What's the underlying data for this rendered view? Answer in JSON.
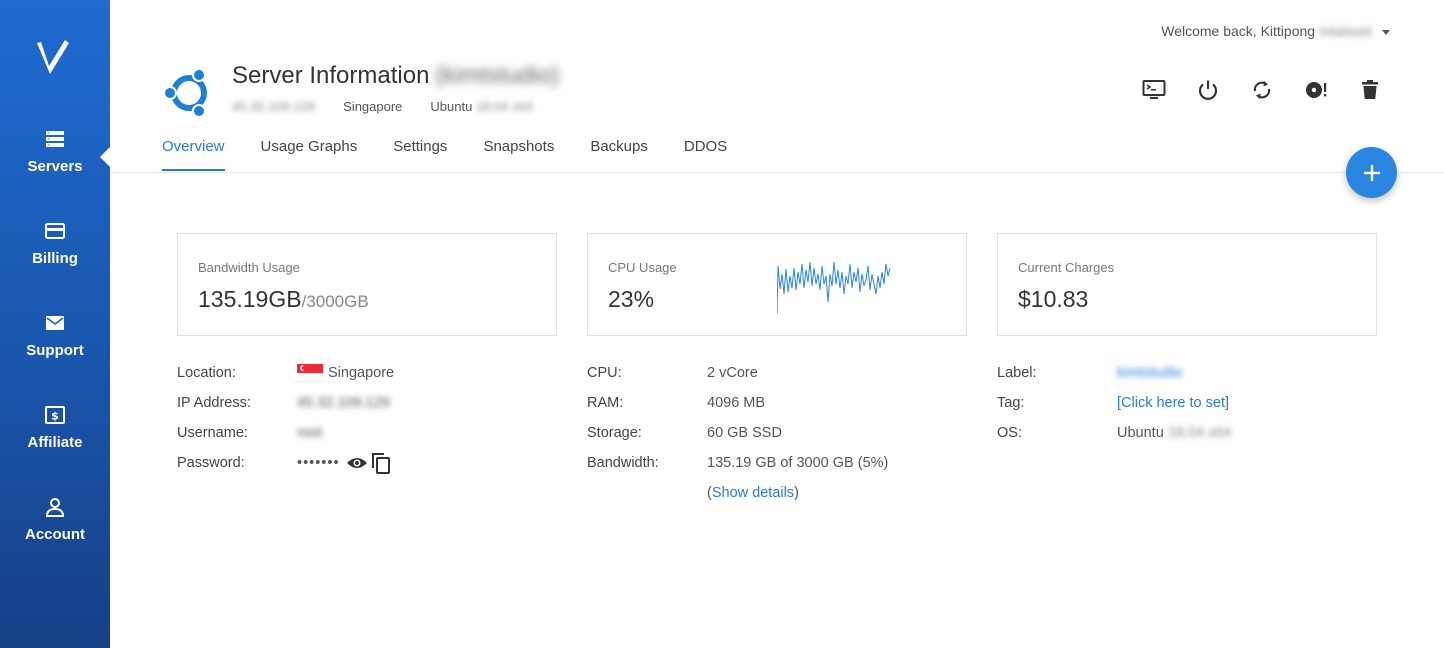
{
  "sidebar": {
    "logo": "V",
    "items": [
      {
        "label": "Servers",
        "icon": "servers-icon"
      },
      {
        "label": "Billing",
        "icon": "credit-card-icon"
      },
      {
        "label": "Support",
        "icon": "envelope-icon"
      },
      {
        "label": "Affiliate",
        "icon": "dollar-bill-icon"
      },
      {
        "label": "Account",
        "icon": "user-icon"
      }
    ],
    "active": "Servers"
  },
  "header": {
    "welcome": "Welcome back, Kittipong",
    "welcome_redacted": "Intalsoet"
  },
  "server": {
    "title": "Server Information",
    "title_redacted": "(kimtstudio)",
    "ip_redacted": "45.32.109.129",
    "location": "Singapore",
    "os": "Ubuntu",
    "os_version_redacted": "18.04 x64"
  },
  "tabs": [
    "Overview",
    "Usage Graphs",
    "Settings",
    "Snapshots",
    "Backups",
    "DDOS"
  ],
  "active_tab": "Overview",
  "cards": {
    "bandwidth": {
      "label": "Bandwidth Usage",
      "value": "135.19GB",
      "sub": "/3000GB"
    },
    "cpu": {
      "label": "CPU Usage",
      "value": "23%"
    },
    "charges": {
      "label": "Current Charges",
      "value": "$10.83"
    }
  },
  "details_left": {
    "location_label": "Location:",
    "location_value": "Singapore",
    "ip_label": "IP Address:",
    "ip_value": "45.32.109.129",
    "username_label": "Username:",
    "username_value": "root",
    "password_label": "Password:",
    "password_value": "•••••••"
  },
  "details_mid": {
    "cpu_label": "CPU:",
    "cpu_value": "2 vCore",
    "ram_label": "RAM:",
    "ram_value": "4096 MB",
    "storage_label": "Storage:",
    "storage_value": "60 GB SSD",
    "bandwidth_label": "Bandwidth:",
    "bandwidth_value": "135.19 GB of 3000 GB (5%)",
    "show_details_open": "(",
    "show_details": "Show details",
    "show_details_close": ")"
  },
  "details_right": {
    "label_label": "Label:",
    "label_value": "kimtstudio",
    "tag_label": "Tag:",
    "tag_value": "[Click here to set]",
    "os_label": "OS:",
    "os_value": "Ubuntu",
    "os_version": "18.04 x64"
  },
  "colors": {
    "accent": "#2a7ad8",
    "sidebar": "#1a56ad",
    "fab": "#2a86e0",
    "ubuntu": "#1e7fd6"
  },
  "actions": [
    "console-icon",
    "power-icon",
    "restart-icon",
    "reinstall-icon",
    "trash-icon"
  ]
}
